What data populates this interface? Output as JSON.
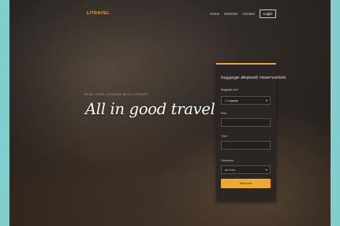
{
  "brand": {
    "name_first": "L",
    "name_rest": "ITRAVEL"
  },
  "nav": {
    "items": [
      "Home",
      "Services",
      "Contact"
    ],
    "login_label": "Login"
  },
  "hero": {
    "eyebrow_prefix": "BOOK YOUR LUGGAGE WITH",
    "eyebrow_accent": "LITRAVEL",
    "headline": "All in good travel!"
  },
  "form": {
    "title": "luggage deposit reservation",
    "fields": [
      {
        "label": "Baggage size",
        "value": "1 Luggage"
      },
      {
        "label": "Start",
        "value": ""
      },
      {
        "label": "Time",
        "value": ""
      },
      {
        "label": "Deposited",
        "value": "per hour"
      }
    ],
    "submit_label": "Book now"
  },
  "colors": {
    "accent": "#f0a830",
    "background_outer": "#7fcfcc",
    "panel_bg": "#2b2623"
  }
}
